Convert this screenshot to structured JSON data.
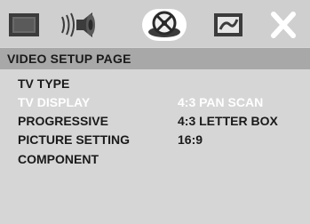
{
  "icons": [
    {
      "name": "general-setup-icon"
    },
    {
      "name": "audio-setup-icon"
    },
    {
      "name": "video-setup-icon"
    },
    {
      "name": "preference-setup-icon"
    },
    {
      "name": "exit-icon"
    }
  ],
  "header": {
    "title": "VIDEO SETUP PAGE"
  },
  "menu": {
    "items": [
      {
        "label": "TV TYPE"
      },
      {
        "label": "TV DISPLAY"
      },
      {
        "label": "PROGRESSIVE"
      },
      {
        "label": "PICTURE SETTING"
      },
      {
        "label": "COMPONENT"
      }
    ],
    "selected_index": 1
  },
  "options": {
    "items": [
      {
        "label": "4:3 PAN SCAN"
      },
      {
        "label": "4:3 LETTER BOX"
      },
      {
        "label": "16:9"
      }
    ],
    "highlighted_index": 0
  },
  "colors": {
    "background": "#d6d6d6",
    "header_bar": "#a8a8a8",
    "text": "#1a1a1a",
    "highlight_text": "#ffffff"
  }
}
